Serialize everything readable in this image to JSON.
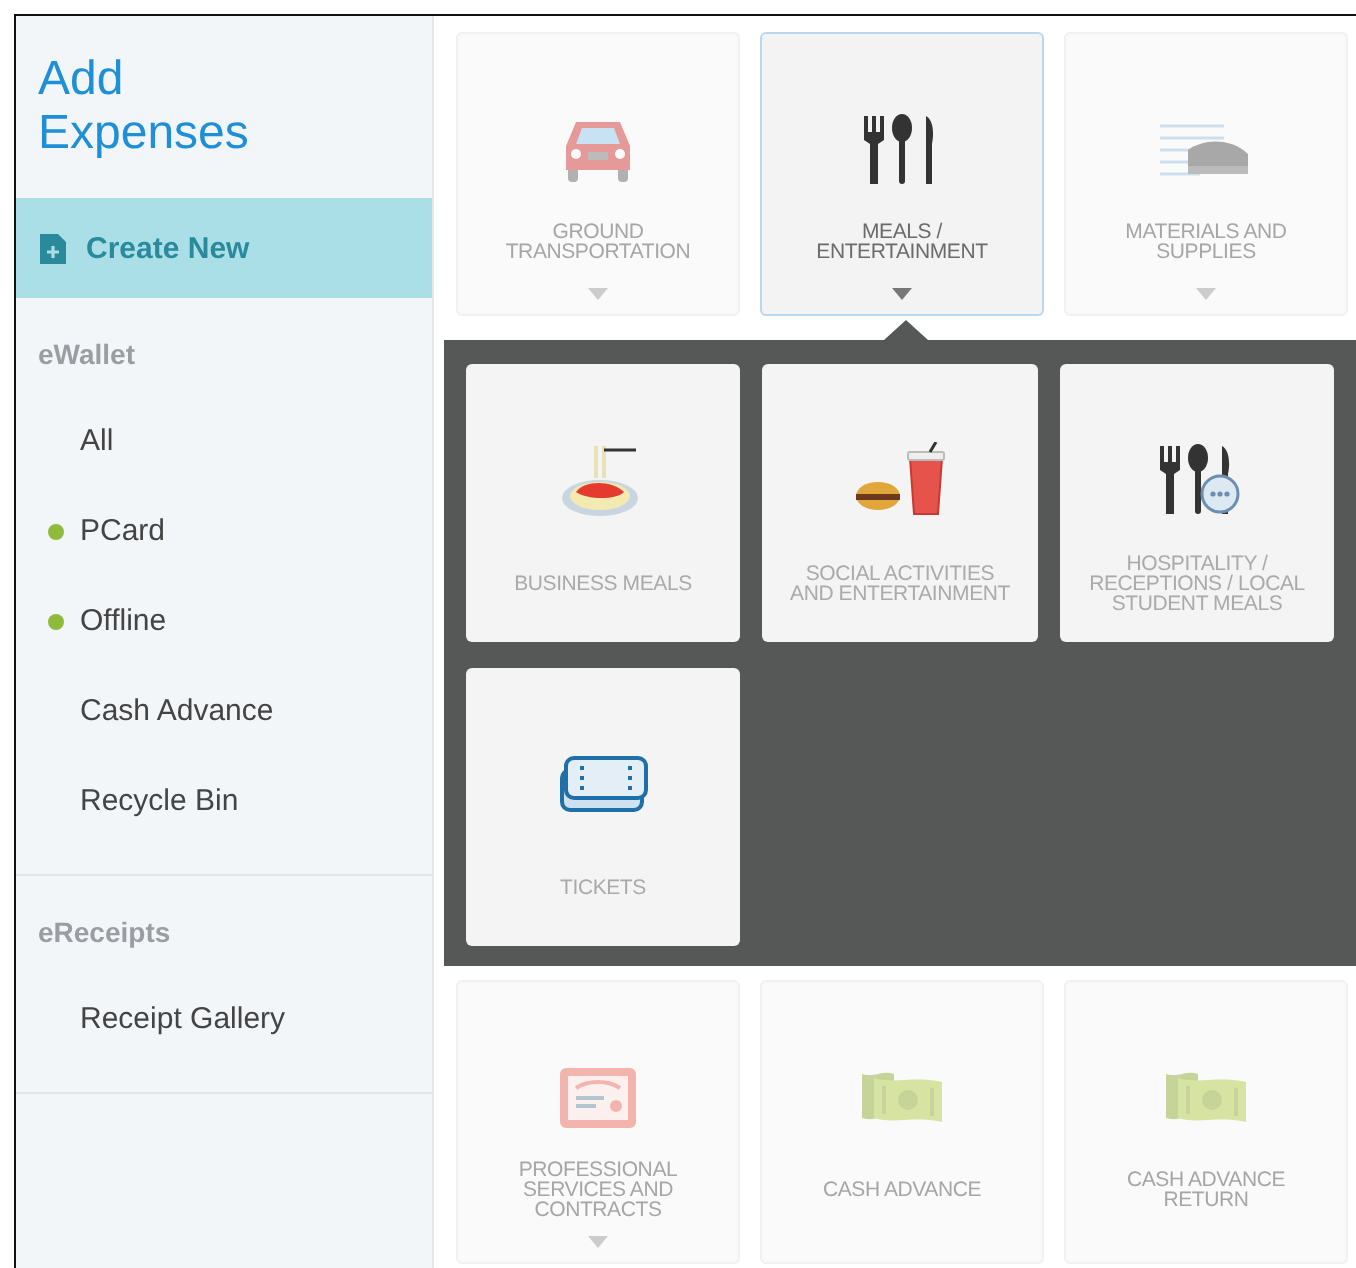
{
  "sidebar": {
    "title": "Add Expenses",
    "create_button": "Create New",
    "sections": [
      {
        "heading": "eWallet",
        "items": [
          {
            "label": "All",
            "dot": false
          },
          {
            "label": "PCard",
            "dot": true
          },
          {
            "label": "Offline",
            "dot": true
          },
          {
            "label": "Cash Advance",
            "dot": false
          },
          {
            "label": "Recycle Bin",
            "dot": false
          }
        ]
      },
      {
        "heading": "eReceipts",
        "items": [
          {
            "label": "Receipt Gallery",
            "dot": false
          }
        ]
      }
    ]
  },
  "categories_top": [
    {
      "label": "GROUND TRANSPORTATION",
      "selected": false,
      "expandable": true
    },
    {
      "label": "MEALS / ENTERTAINMENT",
      "selected": true,
      "expandable": true
    },
    {
      "label": "MATERIALS AND SUPPLIES",
      "selected": false,
      "expandable": true
    }
  ],
  "subcategories": [
    {
      "label": "BUSINESS MEALS"
    },
    {
      "label": "SOCIAL ACTIVITIES AND ENTERTAINMENT"
    },
    {
      "label": "HOSPITALITY / RECEPTIONS / LOCAL STUDENT MEALS"
    },
    {
      "label": "TICKETS"
    }
  ],
  "categories_bottom": [
    {
      "label": "PROFESSIONAL SERVICES AND CONTRACTS",
      "selected": false,
      "expandable": true
    },
    {
      "label": "CASH ADVANCE",
      "selected": false,
      "expandable": false
    },
    {
      "label": "CASH ADVANCE RETURN",
      "selected": false,
      "expandable": false
    }
  ]
}
